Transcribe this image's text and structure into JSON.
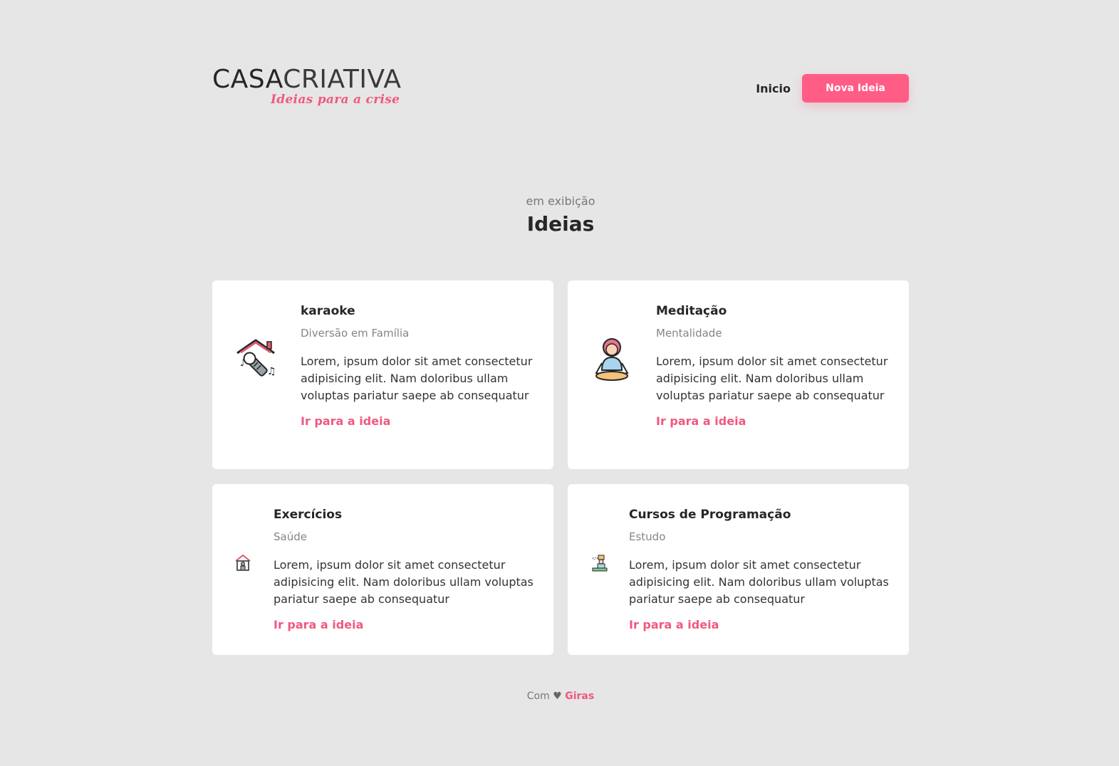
{
  "brand": {
    "title_bold": "CASA",
    "title_light": "CRIATIVA",
    "tagline": "Ideias para a crise"
  },
  "nav": {
    "home_label": "Inicio",
    "new_idea_label": "Nova Ideia"
  },
  "section": {
    "subtitle": "em exibição",
    "title": "Ideias"
  },
  "ideas": [
    {
      "title": "karaoke",
      "category": "Diversão em Família",
      "description": "Lorem, ipsum dolor sit amet consectetur adipisicing elit. Nam doloribus ullam voluptas pariatur saepe ab consequatur",
      "link_label": "Ir para a ideia",
      "icon": "karaoke-house-icon"
    },
    {
      "title": "Meditação",
      "category": "Mentalidade",
      "description": "Lorem, ipsum dolor sit amet consectetur adipisicing elit. Nam doloribus ullam voluptas pariatur saepe ab consequatur",
      "link_label": "Ir para a ideia",
      "icon": "meditation-icon"
    },
    {
      "title": "Exercícios",
      "category": "Saúde",
      "description": "Lorem, ipsum dolor sit amet consectetur adipisicing elit. Nam doloribus ullam voluptas pariatur saepe ab consequatur",
      "link_label": "Ir para a ideia",
      "icon": "home-exercise-icon"
    },
    {
      "title": "Cursos de Programação",
      "category": "Estudo",
      "description": "Lorem, ipsum dolor sit amet consectetur adipisicing elit. Nam doloribus ullam voluptas pariatur saepe ab consequatur",
      "link_label": "Ir para a ideia",
      "icon": "programming-desk-icon"
    }
  ],
  "footer": {
    "prefix": "Com",
    "heart": "♥",
    "author": "Giras"
  },
  "colors": {
    "background": "#e6e6e6",
    "accent": "#ff5c86",
    "link": "#f0587f",
    "card": "#ffffff"
  }
}
